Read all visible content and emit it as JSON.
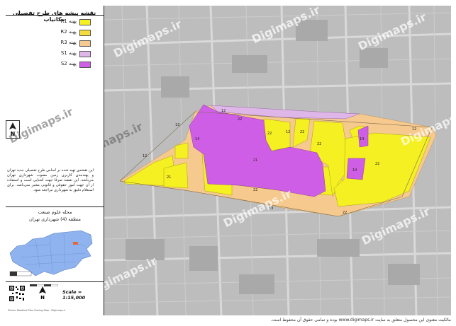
{
  "sidebar": {
    "title": "نقشه پیشه‌ ها‌ی طرح تفصیلی مکانیاب",
    "legend": [
      {
        "label": "پهنه R1",
        "color": "#f5f022"
      },
      {
        "label": "پهنه R2",
        "color": "#f2dd3a"
      },
      {
        "label": "پهنه R3",
        "color": "#f6c98e"
      },
      {
        "label": "پهنه S1",
        "color": "#dfb6e8"
      },
      {
        "label": "پهنه S2",
        "color": "#cf5ee6"
      }
    ],
    "north_label": "N",
    "description": "این نقشه‌ی تهیه شده بر اساس طرح تفصیلی جدید تهران و پهنه‌بندی کاربری زمین مصوب شهرداری تهران می‌باشد. این نقشه صرفا جهت آشنایی است و استفاده از آن جهت امور حقوقی و قانونی معتبر نمی‌باشد. برای استعلام دقیق به شهرداری مراجعه شود.",
    "location_title": "محله علوم صنعت",
    "location_subtitle": "منطقه (4) شهرداری تهران",
    "scale_text": "Scale = 1:15,000",
    "tiny_footer": "Tehran Detailed Plan Zoning Map - Digimaps.ir"
  },
  "map": {
    "watermark": "Digimaps.ir",
    "zone_labels": [
      "12",
      "22",
      "21",
      "14",
      "13",
      "22",
      "22",
      "22",
      "21",
      "12",
      "12",
      "22",
      "14",
      "22",
      "12",
      "14",
      "13",
      "22"
    ]
  },
  "footer": {
    "text": "مالکیت معنوی این محصول متعلق به سایت www.digimaps.ir بوده و تمامی حقوق آن محفوظ است."
  },
  "colors": {
    "R1": "#f5f022",
    "R2": "#f2dd3a",
    "R3": "#f6c98e",
    "S1": "#dfb6e8",
    "S2": "#cf5ee6",
    "basemap": "#bdbdbd"
  }
}
